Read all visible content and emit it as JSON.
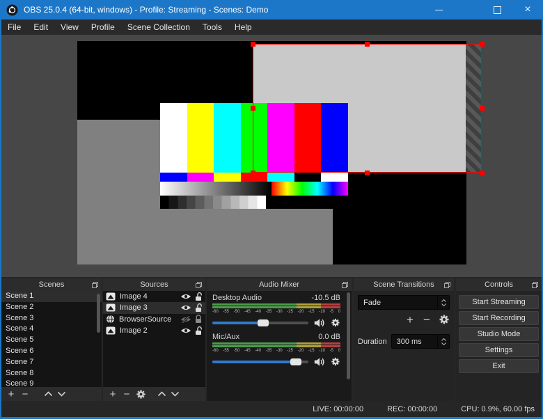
{
  "window": {
    "title": "OBS 25.0.4 (64-bit, windows) - Profile: Streaming - Scenes: Demo",
    "accent_color": "#1d77c8"
  },
  "menu": {
    "items": [
      "File",
      "Edit",
      "View",
      "Profile",
      "Scene Collection",
      "Tools",
      "Help"
    ]
  },
  "preview": {
    "background": "#474747",
    "canvas_color": "#000000",
    "selection_color": "#ff0000",
    "gray_rect_color": "#808080",
    "selected_rect_color": "#c9c9c9",
    "test_pattern": {
      "bars": [
        "#ffffff",
        "#ffff00",
        "#00ffff",
        "#00ff00",
        "#ff00ff",
        "#ff0000",
        "#0000ff"
      ],
      "row2": [
        "#0000ff",
        "#ff00ff",
        "#ffff00",
        "#ff0000",
        "#00ffff",
        "#000000",
        "#ffffff"
      ],
      "grayscale_gradient": [
        "#ffffff",
        "#000000"
      ],
      "rainbow_gradient": [
        "#ff0000",
        "#ffff00",
        "#00ff00",
        "#00ffff",
        "#0000ff",
        "#ff00ff"
      ],
      "steps": [
        "#000000",
        "#171717",
        "#2e2e2e",
        "#454545",
        "#5c5c5c",
        "#737373",
        "#8a8a8a",
        "#a1a1a1",
        "#b8b8b8",
        "#cfcfcf",
        "#e6e6e6",
        "#ffffff"
      ]
    }
  },
  "scenes": {
    "title": "Scenes",
    "items": [
      "Scene 1",
      "Scene 2",
      "Scene 3",
      "Scene 4",
      "Scene 5",
      "Scene 6",
      "Scene 7",
      "Scene 8",
      "Scene 9"
    ],
    "selected": "Scene 1"
  },
  "sources": {
    "title": "Sources",
    "items": [
      {
        "name": "Image 4",
        "icon": "image-source-icon",
        "visible": true,
        "locked": false
      },
      {
        "name": "Image 3",
        "icon": "image-source-icon",
        "visible": true,
        "locked": false,
        "selected": true
      },
      {
        "name": "BrowserSource",
        "icon": "browser-source-icon",
        "visible": false,
        "locked": true
      },
      {
        "name": "Image 2",
        "icon": "image-source-icon",
        "visible": true,
        "locked": false
      }
    ]
  },
  "mixer": {
    "title": "Audio Mixer",
    "ticks": [
      "-60",
      "-55",
      "-50",
      "-45",
      "-40",
      "-35",
      "-30",
      "-25",
      "-20",
      "-15",
      "-10",
      "-5",
      "0"
    ],
    "meter_colors": {
      "green": "#4c9c4c",
      "yellow": "#b0a23c",
      "red": "#b84040"
    },
    "slider_color": "#2e7bcc",
    "channels": [
      {
        "name": "Desktop Audio",
        "db": "-10.5 dB",
        "slider_fill": "53%"
      },
      {
        "name": "Mic/Aux",
        "db": "0.0 dB",
        "slider_fill": "87%"
      }
    ]
  },
  "transitions": {
    "title": "Scene Transitions",
    "selected": "Fade",
    "duration_label": "Duration",
    "duration_value": "300 ms"
  },
  "controls": {
    "title": "Controls",
    "buttons": [
      "Start Streaming",
      "Start Recording",
      "Studio Mode",
      "Settings",
      "Exit"
    ]
  },
  "statusbar": {
    "live": "LIVE: 00:00:00",
    "rec": "REC: 00:00:00",
    "cpu": "CPU: 0.9%, 60.00 fps"
  }
}
